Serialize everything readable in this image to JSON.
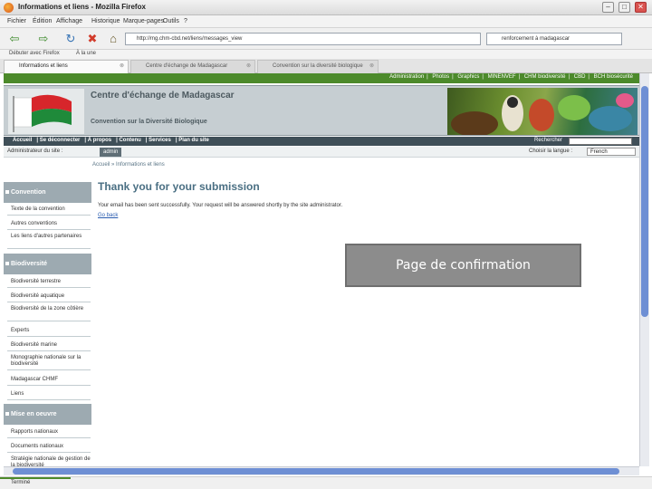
{
  "window": {
    "title": "Informations et liens - Mozilla Firefox"
  },
  "menu": [
    "Fichier",
    "Édition",
    "Affichage",
    "Historique",
    "Marque-pages",
    "Outils",
    "?"
  ],
  "toolbar": {
    "url": "http://mg.chm-cbd.net/liens/messages_view",
    "search_value": "renforcement à madagascar"
  },
  "bookmarks": [
    "Débuter avec Firefox",
    "À la une"
  ],
  "tabs": [
    {
      "label": "Informations et liens",
      "active": true
    },
    {
      "label": "Centre d'échange de Madagascar",
      "active": false
    },
    {
      "label": "Convention sur la diversité biologique",
      "active": false
    }
  ],
  "site": {
    "top_links": [
      "Administration",
      "Photos",
      "Graphics",
      "MINENVEF",
      "CHM biodiversité",
      "CBD",
      "BCH biosécurité"
    ],
    "title": "Centre d'échange de Madagascar",
    "subtitle": "Convention sur la Diversité Biologique",
    "nav": [
      "Accueil",
      "Se déconnecter",
      "À propos",
      "Contenu",
      "Services",
      "Plan du site"
    ],
    "search_label": "Rechercher",
    "user_label": "Administrateur du site :",
    "user_badge": "admin",
    "lang_label": "Choisir la langue :",
    "lang_value": "French",
    "breadcrumb": "Accueil  »  Informations et liens"
  },
  "sidebar": {
    "sections": [
      {
        "title": "Convention",
        "items": [
          "Texte de la convention",
          "Autres conventions",
          "Les liens d'autres partenaires"
        ]
      },
      {
        "title": "Biodiversité",
        "items": [
          "Biodiversité terrestre",
          "Biodiversité aquatique",
          "Biodiversité de la zone côtière",
          "Experts",
          "Biodiversité marine",
          "Monographie nationale sur la biodiversité",
          "Madagascar CHMF",
          "Liens"
        ]
      },
      {
        "title": "Mise en oeuvre",
        "items": [
          "Rapports nationaux",
          "Documents nationaux",
          "Stratégie nationale de gestion de la biodiversité"
        ]
      }
    ]
  },
  "content": {
    "heading": "Thank you for your submission",
    "message": "Your email has been sent successfully. Your request will be answered shortly by the site administrator.",
    "back_link": "Go back"
  },
  "status": {
    "text": "Terminé"
  },
  "overlay": {
    "label": "Page de confirmation"
  },
  "colors": {
    "green": "#4c8a2b",
    "banner": "#c6ced2",
    "nav": "#3f4f58",
    "sidebar_header": "#9daab1",
    "heading": "#4a6f83"
  }
}
